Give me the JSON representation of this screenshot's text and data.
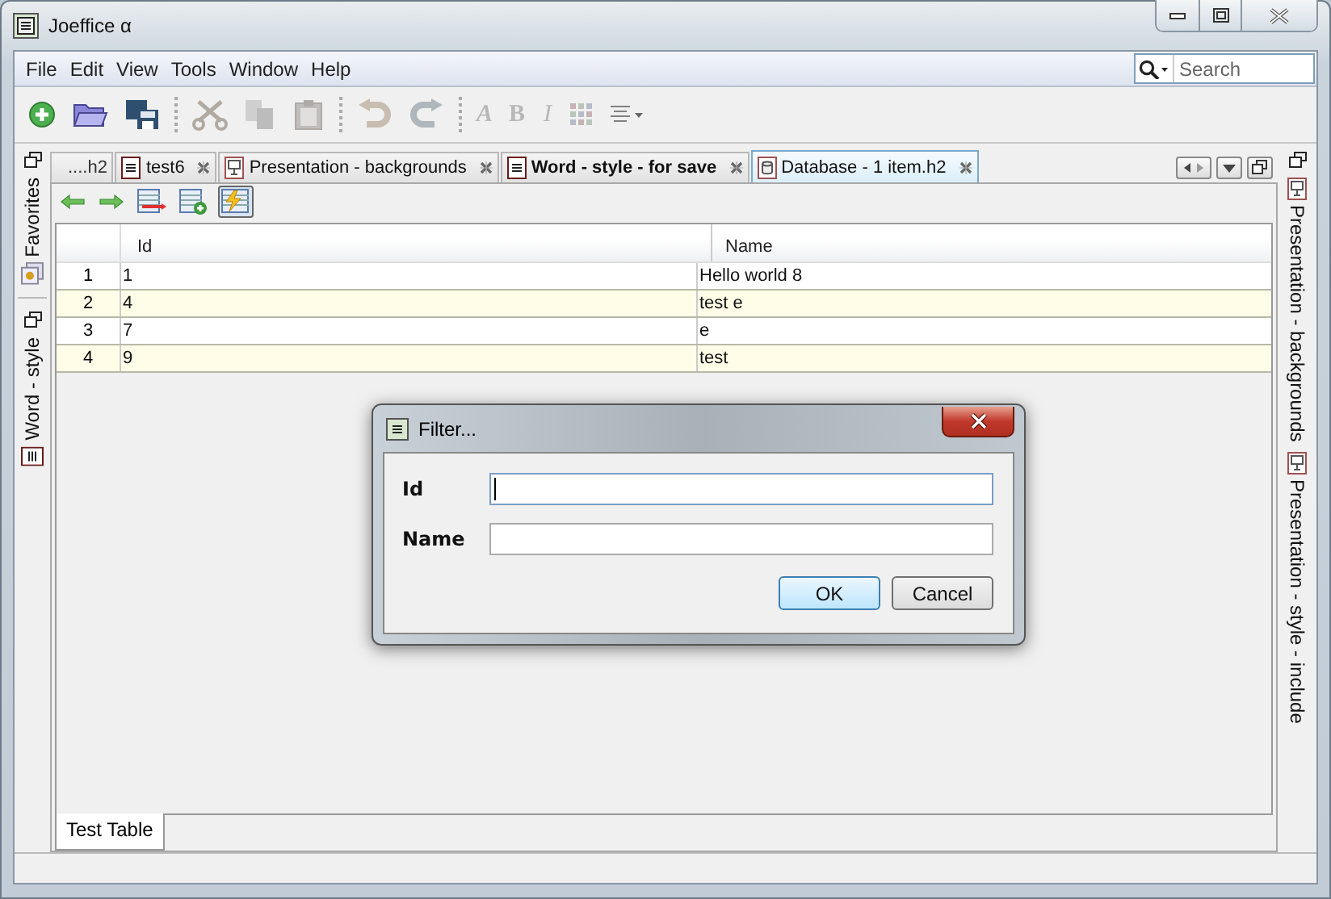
{
  "window": {
    "title": "Joeffice α"
  },
  "menu": [
    "File",
    "Edit",
    "View",
    "Tools",
    "Window",
    "Help"
  ],
  "search": {
    "placeholder": "Search"
  },
  "toolbar": [
    {
      "kind": "new",
      "disabled": false
    },
    {
      "kind": "open",
      "disabled": false
    },
    {
      "kind": "save",
      "disabled": false
    },
    {
      "kind": "separator"
    },
    {
      "kind": "cut",
      "disabled": true
    },
    {
      "kind": "copy",
      "disabled": true
    },
    {
      "kind": "paste",
      "disabled": true
    },
    {
      "kind": "separator"
    },
    {
      "kind": "undo",
      "disabled": true
    },
    {
      "kind": "redo",
      "disabled": true
    },
    {
      "kind": "separator"
    },
    {
      "kind": "bold-italic",
      "label": "A",
      "disabled": true
    },
    {
      "kind": "bold",
      "label": "B",
      "disabled": true
    },
    {
      "kind": "italic",
      "label": "I",
      "disabled": true
    },
    {
      "kind": "grid",
      "disabled": true
    },
    {
      "kind": "align",
      "disabled": true
    }
  ],
  "left_sidebar": [
    {
      "label": "Favorites",
      "kind": "favorites"
    },
    {
      "label": "Word - style",
      "kind": "word"
    }
  ],
  "tabs": [
    {
      "label": "....h2",
      "kind": "none",
      "selected": false,
      "modified": false,
      "closable": false
    },
    {
      "label": "test6",
      "kind": "word",
      "selected": false,
      "modified": false,
      "closable": true
    },
    {
      "label": "Presentation - backgrounds",
      "kind": "presentation",
      "selected": false,
      "modified": false,
      "closable": true
    },
    {
      "label": "Word - style - for save",
      "kind": "word",
      "selected": false,
      "modified": true,
      "closable": true
    },
    {
      "label": "Database - 1 item.h2",
      "kind": "database",
      "selected": true,
      "modified": false,
      "closable": true
    }
  ],
  "editor_toolbar": [
    {
      "kind": "back",
      "selected": false
    },
    {
      "kind": "forward",
      "selected": false
    },
    {
      "kind": "delete-row",
      "selected": false
    },
    {
      "kind": "add-row",
      "selected": false
    },
    {
      "kind": "filter",
      "selected": true
    }
  ],
  "table": {
    "columns": [
      "Id",
      "Name"
    ],
    "rows": [
      {
        "number": "1",
        "cells": [
          "1",
          "Hello world 8"
        ]
      },
      {
        "number": "2",
        "cells": [
          "4",
          "test e"
        ]
      },
      {
        "number": "3",
        "cells": [
          "7",
          "e"
        ]
      },
      {
        "number": "4",
        "cells": [
          "9",
          "test"
        ]
      }
    ]
  },
  "bottom_tabs": [
    {
      "label": "Test Table",
      "selected": true
    }
  ],
  "right_sidebar": [
    {
      "label": "Presentation - backgrounds",
      "kind": "presentation"
    },
    {
      "label": "Presentation - style - include",
      "kind": "presentation"
    }
  ],
  "dialog": {
    "title": "Filter...",
    "fields": [
      {
        "label": "Id",
        "focused": true
      },
      {
        "label": "Name",
        "focused": false
      }
    ],
    "buttons": [
      {
        "label": "OK",
        "default": true
      },
      {
        "label": "Cancel",
        "default": false
      }
    ]
  }
}
